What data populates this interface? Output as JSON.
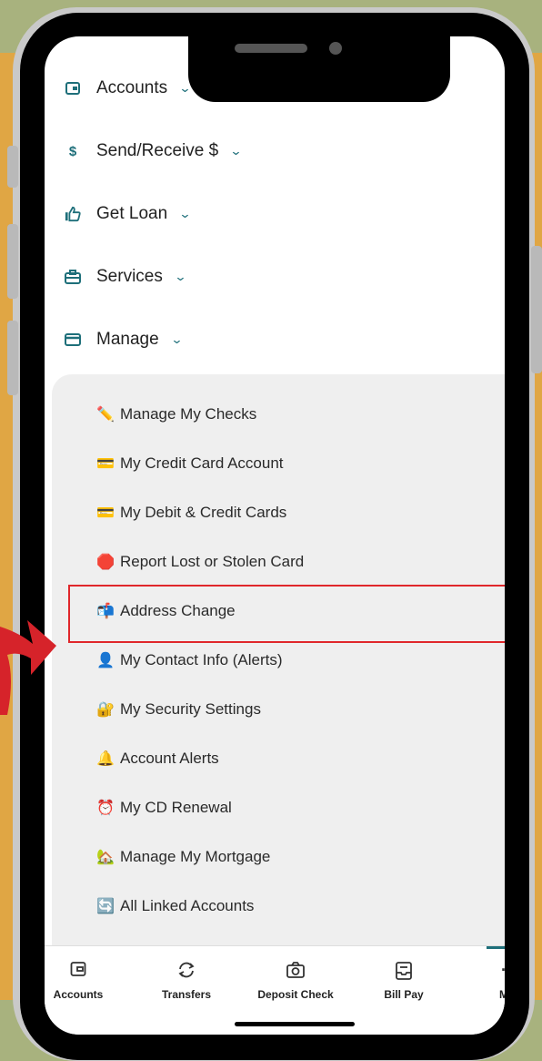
{
  "nav": {
    "items": [
      {
        "label": "Accounts",
        "icon": "wallet-icon"
      },
      {
        "label": "Send/Receive $",
        "icon": "dollar-icon"
      },
      {
        "label": "Get Loan",
        "icon": "thumbs-up-icon"
      },
      {
        "label": "Services",
        "icon": "briefcase-icon"
      },
      {
        "label": "Manage",
        "icon": "card-icon"
      }
    ]
  },
  "manage_menu": {
    "items": [
      {
        "label": "Manage My Checks",
        "emoji": "✏️"
      },
      {
        "label": "My Credit Card Account",
        "emoji": "💳"
      },
      {
        "label": "My Debit & Credit Cards",
        "emoji": "💳"
      },
      {
        "label": "Report Lost or Stolen Card",
        "emoji": "🛑"
      },
      {
        "label": "Address Change",
        "emoji": "📬"
      },
      {
        "label": "My Contact Info (Alerts)",
        "emoji": "👤"
      },
      {
        "label": "My Security Settings",
        "emoji": "🔐"
      },
      {
        "label": "Account Alerts",
        "emoji": "🔔"
      },
      {
        "label": "My CD Renewal",
        "emoji": "⏰"
      },
      {
        "label": "Manage My Mortgage",
        "emoji": "🏡"
      },
      {
        "label": "All Linked Accounts",
        "emoji": "🔄"
      }
    ],
    "highlighted": "Address Change"
  },
  "tabbar": {
    "tabs": [
      {
        "label": "Accounts",
        "icon": "wallet-icon"
      },
      {
        "label": "Transfers",
        "icon": "transfer-icon"
      },
      {
        "label": "Deposit Check",
        "icon": "camera-icon"
      },
      {
        "label": "Bill Pay",
        "icon": "bill-icon"
      },
      {
        "label": "M",
        "icon": "more-icon"
      }
    ]
  },
  "colors": {
    "accent": "#1e6f7a",
    "highlight": "#e0272b",
    "arrow": "#d6232a",
    "background_orange": "#e0a644",
    "background_olive": "#a8b27e"
  }
}
